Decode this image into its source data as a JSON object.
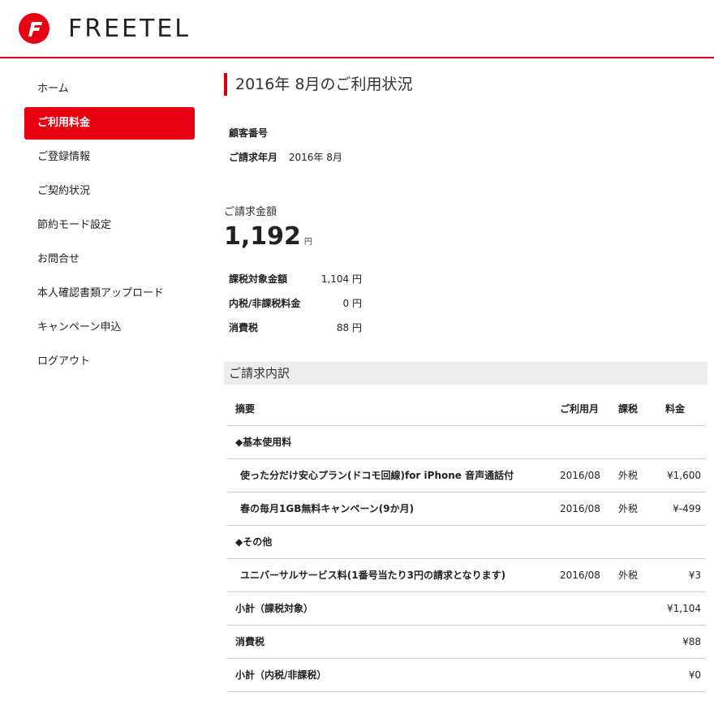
{
  "brand": {
    "name": "FREETEL",
    "accent": "#e60012"
  },
  "sidebar": {
    "items": [
      {
        "label": "ホーム",
        "active": false
      },
      {
        "label": "ご利用料金",
        "active": true
      },
      {
        "label": "ご登録情報",
        "active": false
      },
      {
        "label": "ご契約状況",
        "active": false
      },
      {
        "label": "節約モード設定",
        "active": false
      },
      {
        "label": "お問合せ",
        "active": false
      },
      {
        "label": "本人確認書類アップロード",
        "active": false
      },
      {
        "label": "キャンペーン申込",
        "active": false
      },
      {
        "label": "ログアウト",
        "active": false
      }
    ]
  },
  "main": {
    "title": "2016年 8月のご利用状況",
    "customer_label": "顧客番号",
    "billing_month_label": "ご請求年月",
    "billing_month_value": "2016年 8月",
    "amount_label": "ご請求金額",
    "amount_value": "1,192",
    "amount_unit": "円",
    "tax": [
      {
        "label": "課税対象金額",
        "value": "1,104 円"
      },
      {
        "label": "内税/非課税料金",
        "value": "0 円"
      },
      {
        "label": "消費税",
        "value": "88 円"
      }
    ],
    "breakdown_title": "ご請求内訳"
  },
  "breakdown": {
    "headers": [
      "摘要",
      "ご利用月",
      "課税",
      "料金"
    ],
    "rows": [
      {
        "type": "cat",
        "desc": "◆基本使用料",
        "month": "",
        "tax": "",
        "amount": ""
      },
      {
        "type": "item",
        "desc": "使った分だけ安心プラン(ドコモ回線)for iPhone 音声通話付",
        "month": "2016/08",
        "tax": "外税",
        "amount": "¥1,600"
      },
      {
        "type": "item",
        "desc": "春の毎月1GB無料キャンペーン(9か月)",
        "month": "2016/08",
        "tax": "外税",
        "amount": "¥-499"
      },
      {
        "type": "cat",
        "desc": "◆その他",
        "month": "",
        "tax": "",
        "amount": ""
      },
      {
        "type": "item",
        "desc": "ユニバーサルサービス料(1番号当たり3円の請求となります)",
        "month": "2016/08",
        "tax": "外税",
        "amount": "¥3"
      },
      {
        "type": "total",
        "desc": "小計（課税対象）",
        "month": "",
        "tax": "",
        "amount": "¥1,104"
      },
      {
        "type": "total",
        "desc": "消費税",
        "month": "",
        "tax": "",
        "amount": "¥88"
      },
      {
        "type": "total",
        "desc": "小計（内税/非課税）",
        "month": "",
        "tax": "",
        "amount": "¥0"
      }
    ]
  }
}
